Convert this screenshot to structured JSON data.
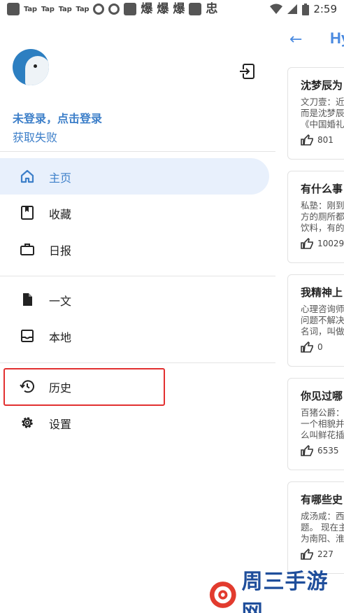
{
  "status_bar": {
    "tap_labels": [
      "Tap",
      "Tap",
      "Tap",
      "Tap"
    ],
    "glyphs": [
      "爆",
      "爆",
      "爆",
      "忠"
    ],
    "time": "2:59"
  },
  "background": {
    "back_icon": "arrow-left-icon",
    "title": "Hy",
    "cards": [
      {
        "title": "沈梦辰为",
        "lines": [
          "文刀壹：近",
          "而是沈梦辰",
          "《中国婚礼"
        ],
        "votes": "801"
      },
      {
        "title": "有什么事",
        "lines": [
          "私塾：刚到",
          "方的厕所都",
          "饮料，有的"
        ],
        "votes": "10029"
      },
      {
        "title": "我精神上",
        "lines": [
          "心理咨询师",
          "问题不解决",
          "名词，叫做"
        ],
        "votes": "0"
      },
      {
        "title": "你见过哪",
        "lines": [
          "百猪公爵：",
          "一个相貌并",
          "么叫鲜花插"
        ],
        "votes": "6535"
      },
      {
        "title": "有哪些史",
        "lines": [
          "成汤咸：西",
          "题。 现在主",
          "为南阳、淮"
        ],
        "votes": "227"
      }
    ]
  },
  "drawer": {
    "login_title": "未登录，点击登录",
    "login_subtitle": "获取失败",
    "items": [
      {
        "label": "主页",
        "icon": "home-icon"
      },
      {
        "label": "收藏",
        "icon": "bookmark-book-icon"
      },
      {
        "label": "日报",
        "icon": "briefcase-icon"
      },
      {
        "label": "一文",
        "icon": "document-icon"
      },
      {
        "label": "本地",
        "icon": "inbox-tray-icon"
      },
      {
        "label": "历史",
        "icon": "history-icon"
      },
      {
        "label": "设置",
        "icon": "gear-icon"
      }
    ]
  },
  "watermark": {
    "text": "周三手游网"
  },
  "colors": {
    "accent": "#3d7fc9",
    "active_bg": "#e8f0fc",
    "highlight": "#e23030"
  }
}
